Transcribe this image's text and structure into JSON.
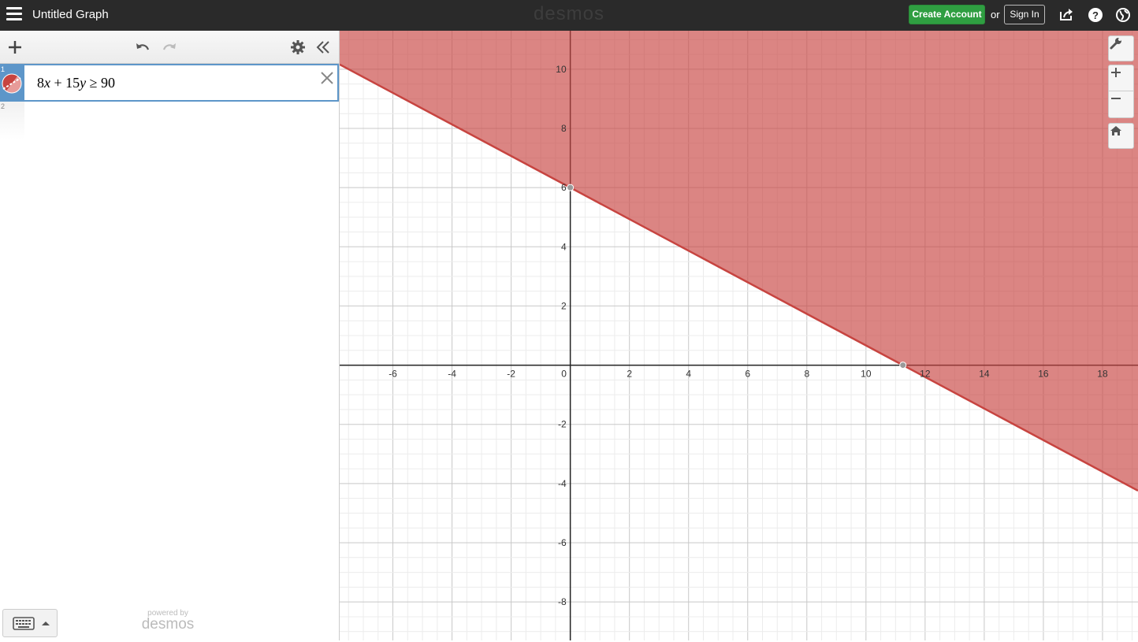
{
  "header": {
    "title": "Untitled Graph",
    "brand": "desmos",
    "create_account_label": "Create Account",
    "or_text": "or",
    "sign_in_label": "Sign In",
    "icons": [
      "menu-icon",
      "share-icon",
      "help-icon",
      "language-globe-icon"
    ]
  },
  "toolbar": {
    "icons": [
      "add-icon",
      "undo-icon",
      "redo-icon",
      "settings-icon",
      "collapse-panel-icon"
    ]
  },
  "expressions": [
    {
      "index": "1",
      "latex": "8x+15y≥90",
      "color": "#c74440",
      "parts": {
        "a": "8",
        "x": "x",
        "plus": " + 15",
        "y": "y",
        "rel": " ≥ 90"
      }
    },
    {
      "index": "2",
      "latex": ""
    }
  ],
  "footer": {
    "powered_by": "powered by",
    "brand": "desmos",
    "keyboard_icon": "keyboard-icon"
  },
  "graph_tools": [
    "wrench-icon",
    "zoom-in-icon",
    "zoom-out-icon",
    "home-icon"
  ],
  "colors": {
    "header_bg": "#2a2a2a",
    "create_account_bg": "#2f9e41",
    "expression_accent": "#5d96c9",
    "inequality_line": "#c74440",
    "inequality_fill": "rgba(199,68,64,0.65)"
  },
  "chart_data": {
    "type": "line",
    "title": "",
    "xlabel": "",
    "ylabel": "",
    "xlim": [
      -7.8,
      19.2
    ],
    "ylim": [
      -9.3,
      11.3
    ],
    "grid": true,
    "x_ticks": [
      "-6",
      "-4",
      "-2",
      "0",
      "2",
      "4",
      "6",
      "8",
      "10",
      "12",
      "14",
      "16",
      "18"
    ],
    "y_ticks": [
      "10",
      "8",
      "6",
      "4",
      "2",
      "-2",
      "-4",
      "-6",
      "-8"
    ],
    "series": [
      {
        "expression": "8x + 15y ≥ 90",
        "kind": "inequality",
        "boundary": {
          "a": 8,
          "b": 15,
          "c": 90
        },
        "shade": "above",
        "color": "#c74440",
        "points": [
          {
            "x": 0,
            "y": 6
          },
          {
            "x": 11.25,
            "y": 0
          }
        ]
      }
    ]
  }
}
